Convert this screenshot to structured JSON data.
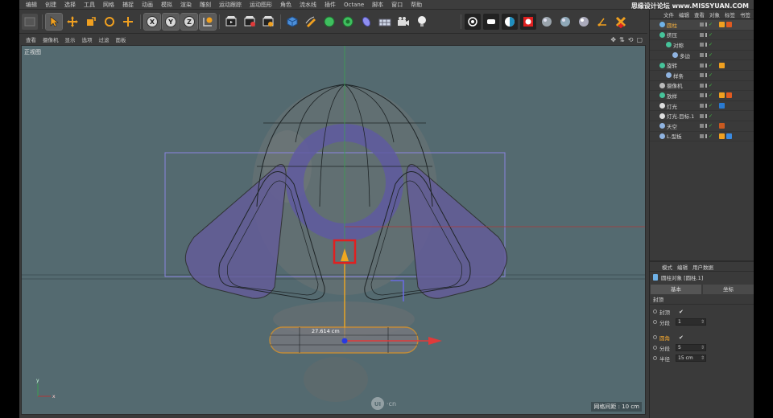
{
  "menu": [
    "编辑",
    "创建",
    "选择",
    "工具",
    "网格",
    "捕捉",
    "动画",
    "模拟",
    "渲染",
    "雕刻",
    "运动跟踪",
    "运动图形",
    "角色",
    "流水线",
    "插件",
    "Octane",
    "脚本",
    "窗口",
    "帮助"
  ],
  "watermark": "思缘设计论坛 www.MISSYUAN.COM",
  "toolbar": {
    "tools": [
      "undo-icon",
      "select-arrow-icon",
      "move-icon",
      "scale-icon",
      "rotate-icon",
      "move-plus-icon",
      "x-axis-icon",
      "y-axis-icon",
      "z-axis-icon",
      "world-coord-icon",
      "render-view-icon",
      "render-picture-icon",
      "render-settings-icon",
      "cube-icon",
      "pen-icon",
      "subdivision-icon",
      "cloner-icon",
      "deformer-icon",
      "floor-icon",
      "camera-icon",
      "light-icon",
      "octane-live-icon",
      "octane-env-icon",
      "octane-split-icon",
      "octane-render-icon",
      "material-sphere-icon",
      "material-sphere2-icon",
      "material-sphere3-icon",
      "axis-widget-icon",
      "render-red-icon"
    ],
    "axis_labels": {
      "x": "X",
      "y": "Y",
      "z": "Z"
    }
  },
  "viewmenu": [
    "查看",
    "摄像机",
    "显示",
    "选项",
    "过滤",
    "面板"
  ],
  "viewport": {
    "label": "正视图",
    "grid_spacing": "网格间距 : 10 cm",
    "dimension": "27.614 cm",
    "logo_text": "·cn",
    "logo_mark": "UI",
    "axis_x": "x",
    "axis_y": "y"
  },
  "objects_panel": {
    "tabs": [
      "文件",
      "编辑",
      "查看",
      "对象",
      "标签",
      "书签"
    ],
    "rows": [
      {
        "name": "圆柱",
        "indent": 0,
        "color": "#6fb2e8",
        "highlight": true
      },
      {
        "name": "挤压",
        "indent": 0,
        "color": "#46c39a"
      },
      {
        "name": "对称",
        "indent": 1,
        "color": "#46c39a"
      },
      {
        "name": "多边",
        "indent": 2,
        "color": "#8fb3e0"
      },
      {
        "name": "旋转",
        "indent": 0,
        "color": "#46c39a"
      },
      {
        "name": "样条",
        "indent": 1,
        "color": "#8fb3e0"
      },
      {
        "name": "摄像机",
        "indent": 0,
        "color": "#bbbbbb"
      },
      {
        "name": "放样",
        "indent": 0,
        "color": "#46c39a"
      },
      {
        "name": "灯光",
        "indent": 0,
        "color": "#dddddd"
      },
      {
        "name": "灯光.目标.1",
        "indent": 0,
        "color": "#dddddd"
      },
      {
        "name": "天空",
        "indent": 0,
        "color": "#8fb3e0"
      },
      {
        "name": "L.型板",
        "indent": 0,
        "color": "#8fb3e0"
      }
    ]
  },
  "attributes": {
    "tabs": [
      "模式",
      "编辑",
      "用户数据"
    ],
    "title": "圆柱对象 [圆柱.1]",
    "subtabs": [
      "基本",
      "坐标"
    ],
    "section": "封顶",
    "props": [
      {
        "label": "封顶",
        "type": "check",
        "value": "✔"
      },
      {
        "label": "分段",
        "type": "num",
        "value": "1"
      },
      {
        "label": "圆角",
        "type": "check",
        "value": "✔",
        "highlight": true
      },
      {
        "label": "分段",
        "type": "num",
        "value": "5"
      },
      {
        "label": "半径",
        "type": "num",
        "value": "15 cm"
      }
    ]
  },
  "colors": {
    "viewport_bg": "#546a70",
    "highlight_box": "#e02020",
    "y_arrow": "#f0a820",
    "x_arrow": "#e03a3a",
    "selection_outline": "#f09a20",
    "bounding_box": "#8a84e0"
  }
}
